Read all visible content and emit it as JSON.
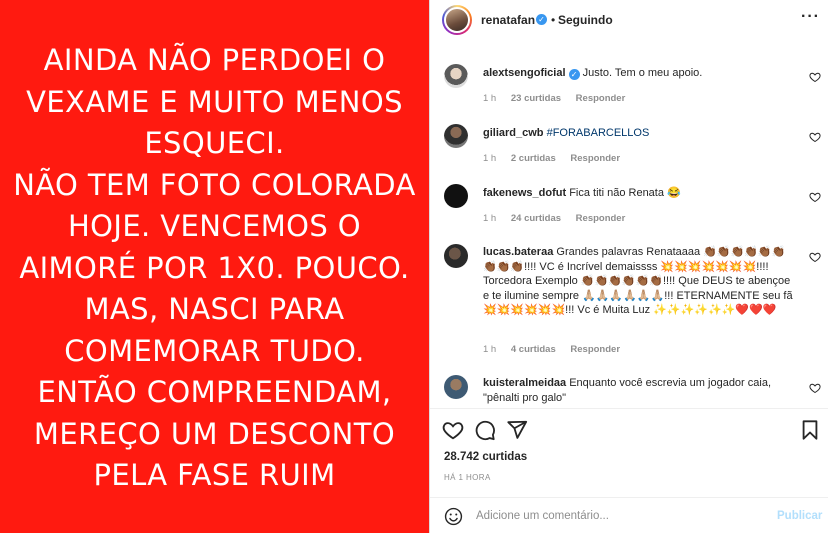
{
  "post": {
    "text": "AINDA NÃO PERDOEI O\nVEXAME E MUITO MENOS\nESQUECI.\nNÃO TEM FOTO COLORADA\nHOJE. VENCEMOS O\nAIMORÉ POR 1X0. POUCO.\nMAS, NASCI PARA\nCOMEMORAR TUDO.\nENTÃO COMPREENDAM,\nMEREÇO UM DESCONTO\nPELA FASE RUIM",
    "background_color": "#ff1a10"
  },
  "header": {
    "username": "renatafan",
    "verified_icon": "verified-badge-icon",
    "separator": "•",
    "follow_status": "Seguindo",
    "more_icon": "more-options-icon",
    "more_glyph": "···"
  },
  "comments": [
    {
      "username": "alextsengoficial",
      "verified": true,
      "text": "Justo. Tem o meu apoio.",
      "time": "1 h",
      "likes": "23 curtidas",
      "reply": "Responder"
    },
    {
      "username": "giliard_cwb",
      "verified": false,
      "text": "#FORABARCELLOS",
      "time": "1 h",
      "likes": "2 curtidas",
      "reply": "Responder"
    },
    {
      "username": "fakenews_dofut",
      "verified": false,
      "text": "Fica titi não Renata 😂",
      "time": "1 h",
      "likes": "24 curtidas",
      "reply": "Responder"
    },
    {
      "username": "lucas.bateraa",
      "verified": false,
      "text": "Grandes palavras Renataaaa 👏🏾👏🏾👏🏾👏🏾👏🏾👏🏾👏🏾👏🏾👏🏾!!!! VC é Incrível demaissss 💥💥💥💥💥💥💥!!!! Torcedora Exemplo 👏🏾👏🏾👏🏾👏🏾👏🏾👏🏾!!!! Que DEUS te abençoe e te ilumine sempre 🙏🏼🙏🏼🙏🏼🙏🏼🙏🏼🙏🏼!!! ETERNAMENTE seu fã 💥💥💥💥💥💥!!! Vc é Muita Luz ✨✨✨✨✨✨❤️❤️❤️",
      "time": "1 h",
      "likes": "4 curtidas",
      "reply": "Responder"
    },
    {
      "username": "kuisteralmeidaa",
      "verified": false,
      "text": "Enquanto você escrevia um jogador caia, \"pênalti pro galo\"",
      "time": "",
      "likes": "",
      "reply": ""
    }
  ],
  "actions": {
    "like_icon": "heart-icon",
    "comment_icon": "comment-icon",
    "share_icon": "share-icon",
    "save_icon": "bookmark-icon"
  },
  "likes_total": "28.742 curtidas",
  "posted_time": "HÁ 1 HORA",
  "add_comment": {
    "placeholder": "Adicione um comentário...",
    "publish_label": "Publicar",
    "emoji_icon": "emoji-icon"
  },
  "colors": {
    "accent": "#0095f6",
    "publish_disabled": "#b2dffc",
    "secondary_text": "#8e8e8e",
    "verified": "#3897f0"
  }
}
